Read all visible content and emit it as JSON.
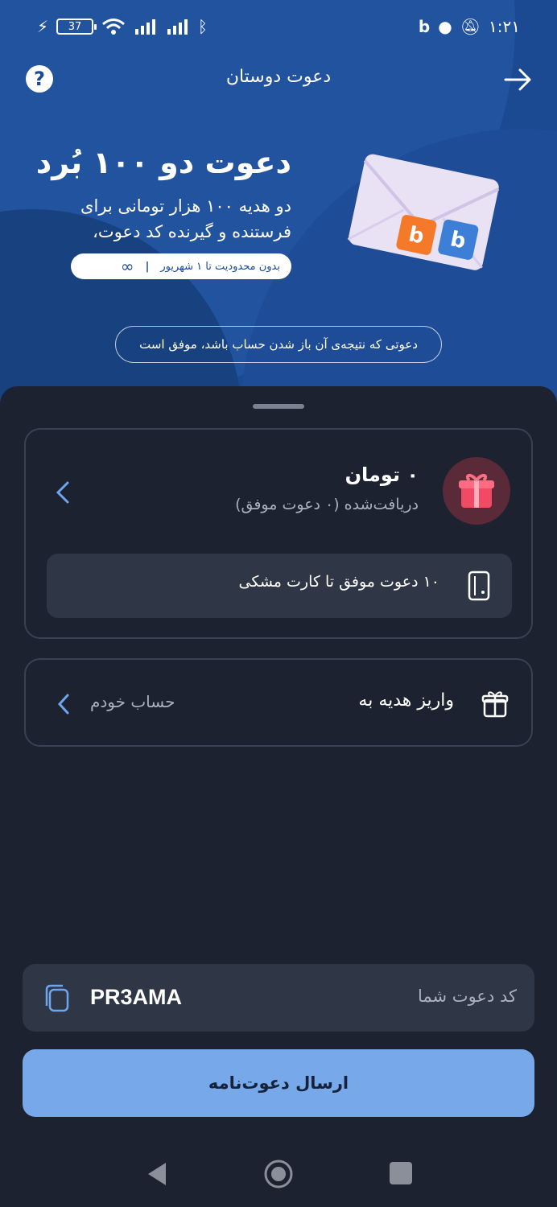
{
  "status_bar": {
    "battery": "37",
    "time": "۱:۲۱"
  },
  "header": {
    "title": "دعوت دوستان",
    "help_icon": "help-icon",
    "back_icon": "arrow-right-icon"
  },
  "promo": {
    "title": "دعوت دو ۱۰۰ بُرد",
    "description": "دو هدیه ۱۰۰ هزار تومانی برای فرستنده و گیرنده کد دعوت،",
    "limit_text": "بدون محدودیت تا ۱ شهریور",
    "success_note": "دعوتی که نتیجه‌ی آن باز شدن حساب باشد، موفق است"
  },
  "rewards": {
    "amount": "۰ تومان",
    "received": "دریافت‌شده (۰ دعوت موفق)",
    "milestone": "۱۰ دعوت موفق تا کارت مشکی"
  },
  "deposit": {
    "label": "واریز هدیه به",
    "value": "حساب خودم"
  },
  "invite": {
    "code_label": "کد دعوت شما",
    "code": "PR3AMA",
    "send_label": "ارسال دعوت‌نامه"
  },
  "colors": {
    "hero_bg": "#1b4a93",
    "sheet_bg": "#1c2230",
    "card_bg": "#2f3645",
    "accent_button": "#77a9ea",
    "gift_red": "#f04a64"
  }
}
